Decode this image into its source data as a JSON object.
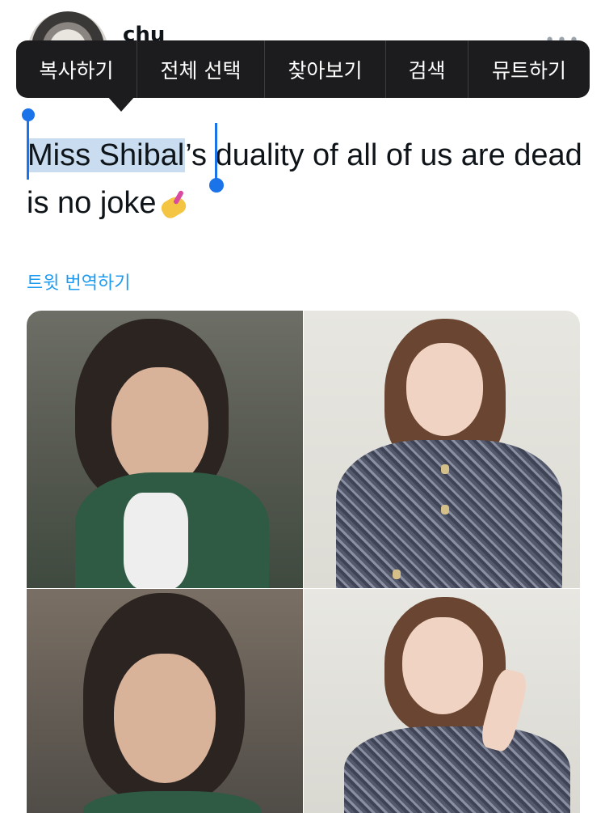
{
  "header": {
    "username": "chu",
    "more_icon": "more-dots-icon"
  },
  "context_menu": {
    "items": [
      "복사하기",
      "전체 선택",
      "찾아보기",
      "검색",
      "뮤트하기"
    ]
  },
  "tweet": {
    "selected_text": "Miss Shibal",
    "remaining_text": "’s duality of all of us are dead is no joke",
    "emoji": "nail-polish-emoji"
  },
  "translate_link": "트윗 번역하기",
  "colors": {
    "menu_bg": "#1c1c1e",
    "selection": "#c9dcf0",
    "handle": "#1a73e8",
    "link": "#1d9bf0"
  }
}
